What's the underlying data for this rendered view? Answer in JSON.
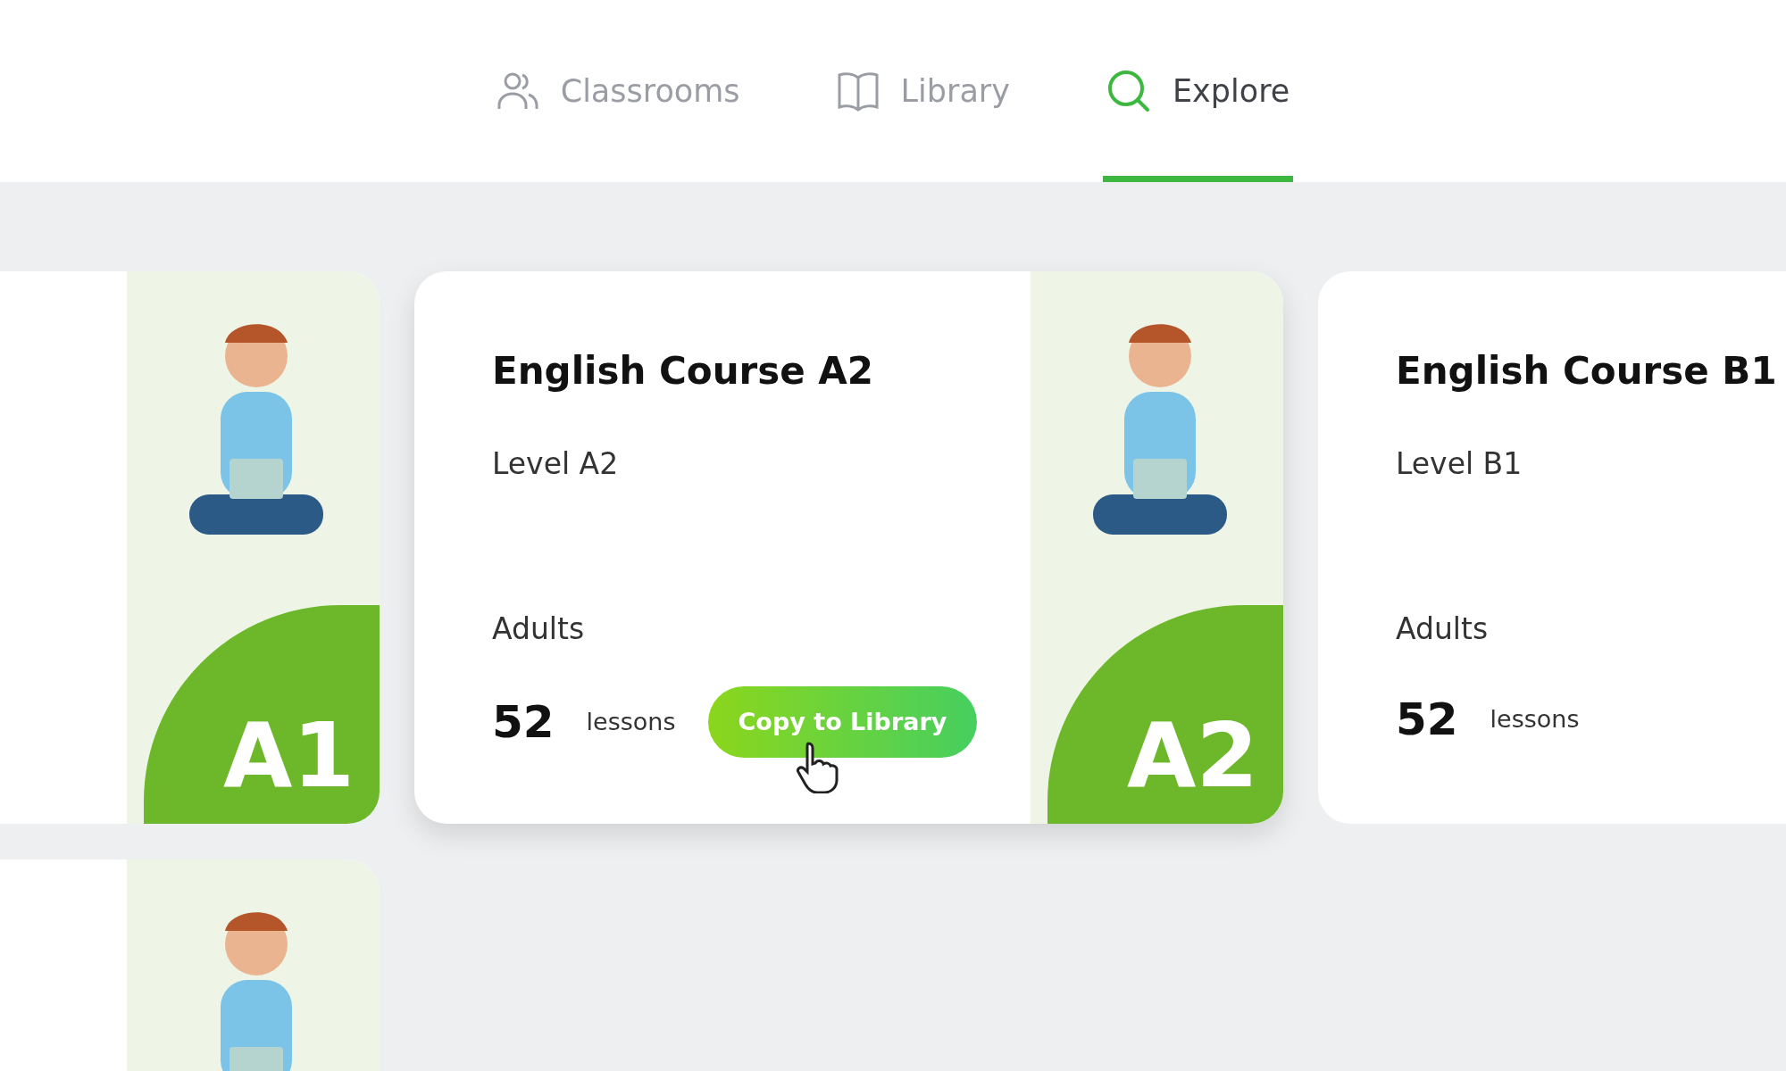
{
  "tabs": [
    {
      "kind": "classrooms",
      "label": "Classrooms",
      "selected": false
    },
    {
      "kind": "library",
      "label": "Library",
      "selected": false
    },
    {
      "kind": "explore",
      "label": "Explore",
      "selected": true
    }
  ],
  "rows": [
    [
      {
        "kind": "image",
        "badge": "A1"
      },
      {
        "kind": "full",
        "title": "English Course A2",
        "level": "Level A2",
        "audience": "Adults",
        "count": "52",
        "unit": "lessons",
        "button": {
          "label": "Copy to Library",
          "hovered": true
        },
        "badge": "A2"
      },
      {
        "kind": "text",
        "title": "English Course B1",
        "level": "Level B1",
        "audience": "Adults",
        "count": "52",
        "unit": "lessons"
      }
    ],
    [
      {
        "kind": "image"
      }
    ]
  ]
}
